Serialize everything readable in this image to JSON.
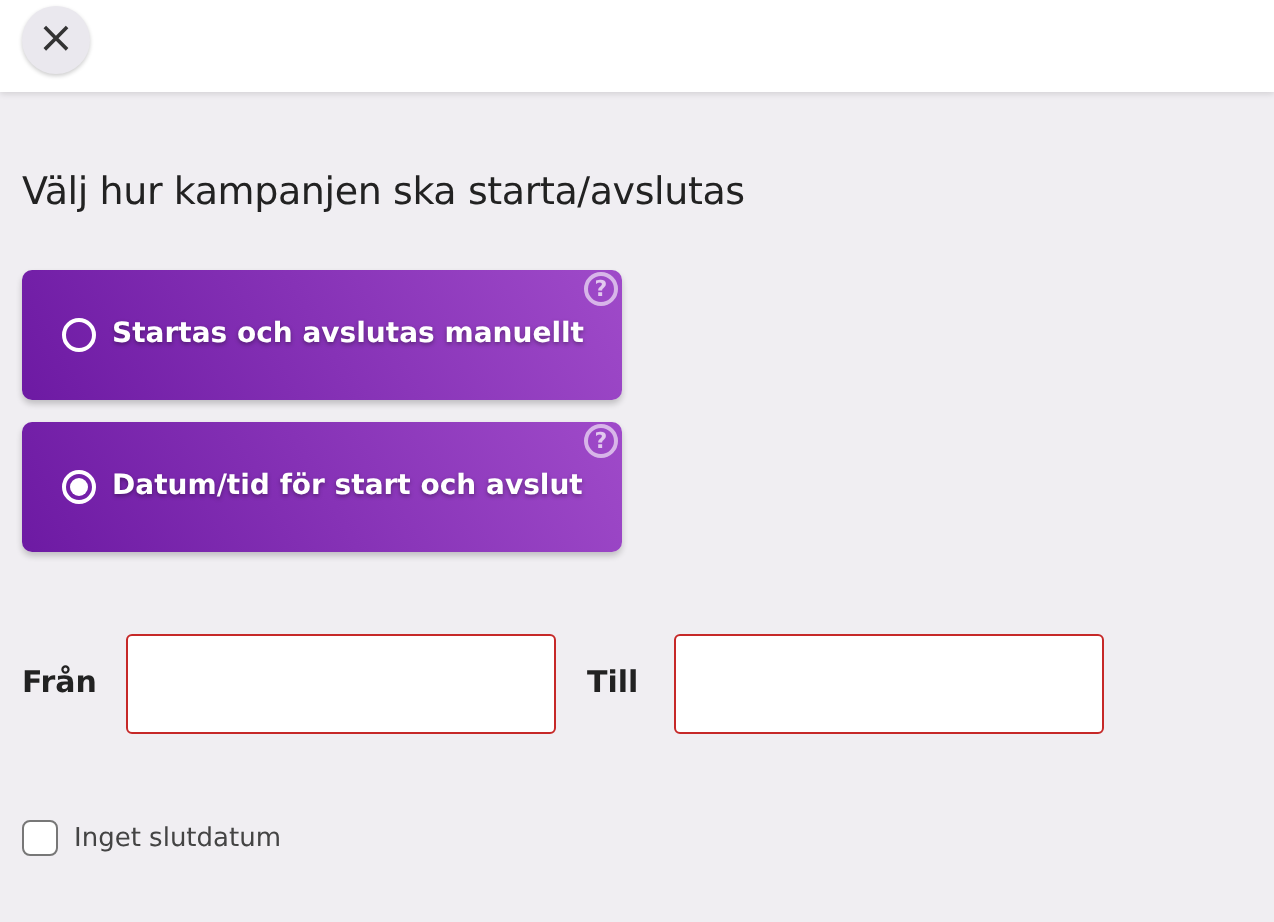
{
  "close_button": {
    "label": "×"
  },
  "heading": "Välj hur kampanjen ska starta/avslutas",
  "options": [
    {
      "label": "Startas och avslutas manuellt",
      "selected": false,
      "help": "?"
    },
    {
      "label": "Datum/tid för start och avslut",
      "selected": true,
      "help": "?"
    }
  ],
  "date_fields": [
    {
      "label": "Från",
      "invalid": true
    },
    {
      "label": "Till",
      "invalid": true
    }
  ],
  "no_end_date": {
    "label": "Inget slutdatum",
    "checked": false
  }
}
